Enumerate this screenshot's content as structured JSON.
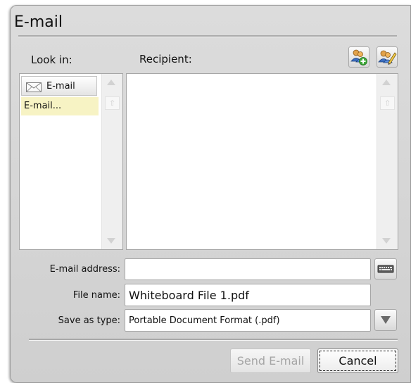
{
  "dialog": {
    "title": "E-mail",
    "look_in_label": "Look in:",
    "recipient_label": "Recipient:",
    "sources": [
      {
        "label": "E-mail",
        "icon": "envelope-icon"
      },
      {
        "label": "E-mail...",
        "selected": true
      }
    ],
    "fields": {
      "email_address": {
        "label": "E-mail address:",
        "value": ""
      },
      "file_name": {
        "label": "File name:",
        "value": "Whiteboard File 1.pdf"
      },
      "save_as_type": {
        "label": "Save as type:",
        "value": "Portable Document Format (.pdf)"
      }
    },
    "buttons": {
      "send": "Send E-mail",
      "cancel": "Cancel"
    },
    "icons": {
      "add_contact": "add-contact-icon",
      "edit_contacts": "edit-contacts-icon",
      "keyboard": "keyboard-icon",
      "dropdown": "dropdown-arrow-icon"
    },
    "colors": {
      "selected_item_bg": "#f7f3c4",
      "dialog_bg": "#d6d6d6",
      "disabled_text": "#a5a5a5"
    }
  }
}
